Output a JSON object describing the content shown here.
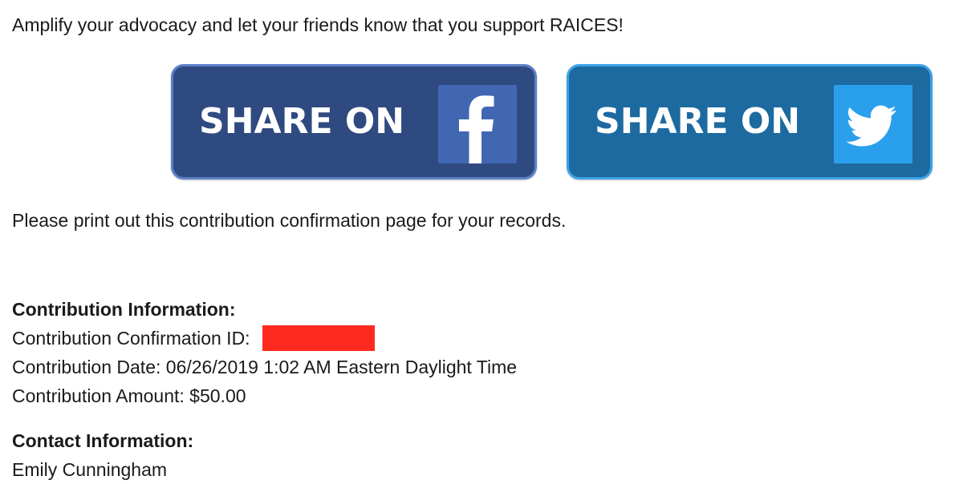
{
  "intro_text": "Amplify your advocacy and let your friends know that you support RAICES!",
  "share": {
    "facebook": {
      "label": "SHARE ON",
      "icon": "facebook-f-icon",
      "bg_color": "#2f4a80",
      "icon_bg_color": "#4267b2"
    },
    "twitter": {
      "label": "SHARE ON",
      "icon": "twitter-bird-icon",
      "bg_color": "#1c6aa0",
      "icon_bg_color": "#2aa0ec"
    }
  },
  "print_note": "Please print out this contribution confirmation page for your records.",
  "contribution": {
    "heading": "Contribution Information:",
    "confirmation_id_label": "Contribution Confirmation ID:",
    "confirmation_id_redaction_color": "#ff2a1f",
    "date_line": "Contribution Date: 06/26/2019 1:02 AM Eastern Daylight Time",
    "amount_line": "Contribution Amount: $50.00"
  },
  "contact": {
    "heading": "Contact Information:",
    "name": "Emily Cunningham"
  }
}
